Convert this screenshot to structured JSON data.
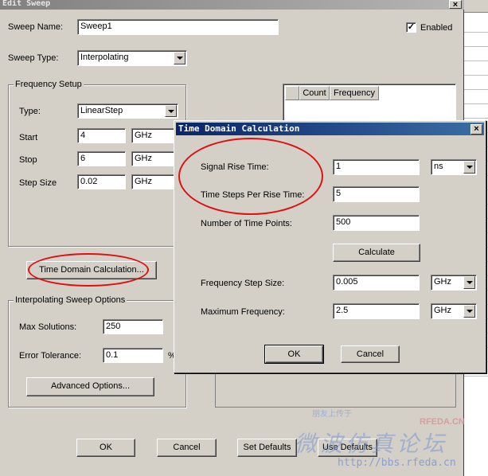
{
  "edit_sweep": {
    "title": "Edit Sweep",
    "close_glyph": "×",
    "sweep_name_label": "Sweep Name:",
    "sweep_name_value": "Sweep1",
    "enabled_label": "Enabled",
    "enabled_check": "✓",
    "sweep_type_label": "Sweep Type:",
    "sweep_type_value": "Interpolating",
    "frequency_setup_label": "Frequency Setup",
    "type_label": "Type:",
    "type_value": "LinearStep",
    "start_label": "Start",
    "start_value": "4",
    "start_unit": "GHz",
    "stop_label": "Stop",
    "stop_value": "6",
    "stop_unit": "GHz",
    "step_size_label": "Step Size",
    "step_size_value": "0.02",
    "step_size_unit": "GHz",
    "table_headers": [
      "Count",
      "Frequency"
    ],
    "time_domain_button": "Time Domain Calculation...",
    "interp_options_label": "Interpolating Sweep Options",
    "max_solutions_label": "Max Solutions:",
    "max_solutions_value": "250",
    "error_tolerance_label": "Error Tolerance:",
    "error_tolerance_value": "0.1",
    "error_tolerance_unit": "%",
    "advanced_options_button": "Advanced Options...",
    "ok_button": "OK",
    "cancel_button": "Cancel",
    "set_defaults_button": "Set Defaults",
    "use_defaults_button": "Use Defaults"
  },
  "tdc": {
    "title": "Time Domain Calculation",
    "close_glyph": "×",
    "rise_time_label": "Signal Rise Time:",
    "rise_time_value": "1",
    "rise_time_unit": "ns",
    "steps_label": "Time Steps Per Rise Time:",
    "steps_value": "5",
    "points_label": "Number of Time Points:",
    "points_value": "500",
    "calculate_button": "Calculate",
    "freq_step_label": "Frequency Step Size:",
    "freq_step_value": "0.005",
    "freq_step_unit": "GHz",
    "max_freq_label": "Maximum Frequency:",
    "max_freq_value": "2.5",
    "max_freq_unit": "GHz",
    "ok_button": "OK",
    "cancel_button": "Cancel"
  },
  "watermark": {
    "line1": "朋友上传于",
    "line2": "RFEDA.CN",
    "line3": "微波仿真论坛",
    "line4": "http://bbs.rfeda.cn"
  },
  "annotation_color": "#e01010"
}
